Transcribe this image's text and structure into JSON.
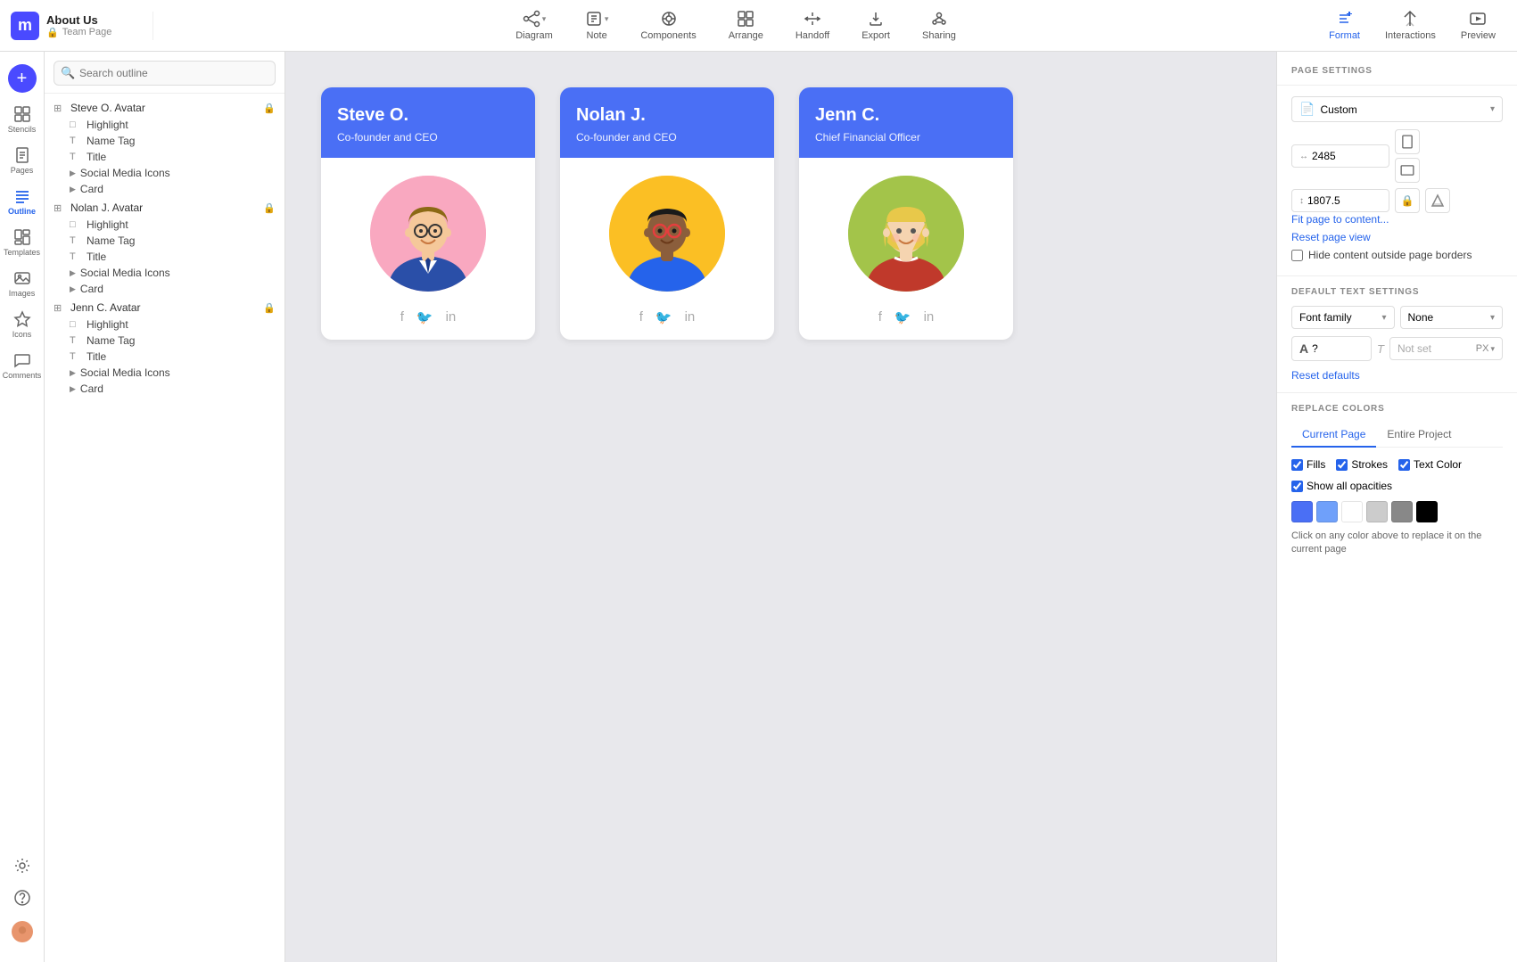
{
  "app": {
    "logo_letter": "m",
    "doc_title": "About Us",
    "doc_subtitle": "Team Page",
    "lock_icon": "🔒"
  },
  "toolbar": {
    "items": [
      {
        "id": "diagram",
        "label": "Diagram",
        "icon": "diagram"
      },
      {
        "id": "note",
        "label": "Note",
        "icon": "note"
      },
      {
        "id": "components",
        "label": "Components",
        "icon": "components"
      },
      {
        "id": "arrange",
        "label": "Arrange",
        "icon": "arrange"
      },
      {
        "id": "handoff",
        "label": "Handoff",
        "icon": "handoff"
      },
      {
        "id": "export",
        "label": "Export",
        "icon": "export"
      },
      {
        "id": "sharing",
        "label": "Sharing",
        "icon": "sharing"
      }
    ],
    "right_items": [
      {
        "id": "format",
        "label": "Format",
        "active": true
      },
      {
        "id": "interactions",
        "label": "Interactions",
        "active": false
      },
      {
        "id": "preview",
        "label": "Preview",
        "active": false
      }
    ]
  },
  "iconbar": {
    "top_items": [
      {
        "id": "stencils",
        "label": "Stencils"
      },
      {
        "id": "pages",
        "label": "Pages"
      },
      {
        "id": "outline",
        "label": "Outline",
        "active": true
      },
      {
        "id": "templates",
        "label": "Templates"
      },
      {
        "id": "images",
        "label": "Images"
      },
      {
        "id": "icons2",
        "label": "Icons"
      }
    ],
    "bottom_items": [
      {
        "id": "settings",
        "label": ""
      },
      {
        "id": "help",
        "label": ""
      },
      {
        "id": "user",
        "label": ""
      }
    ]
  },
  "outline": {
    "search_placeholder": "Search outline",
    "tree": [
      {
        "id": "steve-avatar",
        "label": "Steve O. Avatar",
        "icon": "component",
        "locked": true,
        "children": [
          {
            "label": "Highlight",
            "icon": "shape"
          },
          {
            "label": "Name Tag",
            "icon": "text"
          },
          {
            "label": "Title",
            "icon": "text"
          },
          {
            "label": "Social Media Icons",
            "icon": "group",
            "expandable": true
          },
          {
            "label": "Card",
            "icon": "group",
            "expandable": true
          }
        ]
      },
      {
        "id": "nolan-avatar",
        "label": "Nolan J. Avatar",
        "icon": "component",
        "locked": true,
        "children": [
          {
            "label": "Highlight",
            "icon": "shape"
          },
          {
            "label": "Name Tag",
            "icon": "text"
          },
          {
            "label": "Title",
            "icon": "text"
          },
          {
            "label": "Social Media Icons",
            "icon": "group",
            "expandable": true
          },
          {
            "label": "Card",
            "icon": "group",
            "expandable": true
          }
        ]
      },
      {
        "id": "jenn-avatar",
        "label": "Jenn C. Avatar",
        "icon": "component",
        "locked": true,
        "children": [
          {
            "label": "Highlight",
            "icon": "shape"
          },
          {
            "label": "Name Tag",
            "icon": "text"
          },
          {
            "label": "Title",
            "icon": "text"
          },
          {
            "label": "Social Media Icons",
            "icon": "group",
            "expandable": true
          },
          {
            "label": "Card",
            "icon": "group",
            "expandable": true
          }
        ]
      }
    ]
  },
  "cards": [
    {
      "id": "steve",
      "name": "Steve O.",
      "role": "Co-founder and CEO",
      "avatar_bg": "steve"
    },
    {
      "id": "nolan",
      "name": "Nolan J.",
      "role": "Co-founder and CEO",
      "avatar_bg": "nolan"
    },
    {
      "id": "jenn",
      "name": "Jenn C.",
      "role": "Chief Financial Officer",
      "avatar_bg": "jenn"
    }
  ],
  "right_panel": {
    "page_settings_label": "PAGE SETTINGS",
    "page_type": "Custom",
    "width": "2485",
    "height": "1807.5",
    "fit_page_label": "Fit page to content...",
    "reset_page_label": "Reset page view",
    "hide_content_label": "Hide content outside page borders",
    "default_text_label": "DEFAULT TEXT SETTINGS",
    "font_family_label": "Font family",
    "font_family_value": "",
    "font_weight_value": "None",
    "font_size_value": "?",
    "font_size_unit": "PX",
    "not_set_value": "Not set",
    "reset_defaults_label": "Reset defaults",
    "replace_colors_label": "REPLACE COLORS",
    "tab_current": "Current Page",
    "tab_entire": "Entire Project",
    "fills_label": "Fills",
    "strokes_label": "Strokes",
    "text_color_label": "Text Color",
    "show_opacities_label": "Show all opacities",
    "color_hint": "Click on any color above to replace it on the current page",
    "swatches": [
      "#4a6ff5",
      "#6fa0fa",
      "#ffffff",
      "#cccccc",
      "#888888",
      "#000000"
    ]
  }
}
